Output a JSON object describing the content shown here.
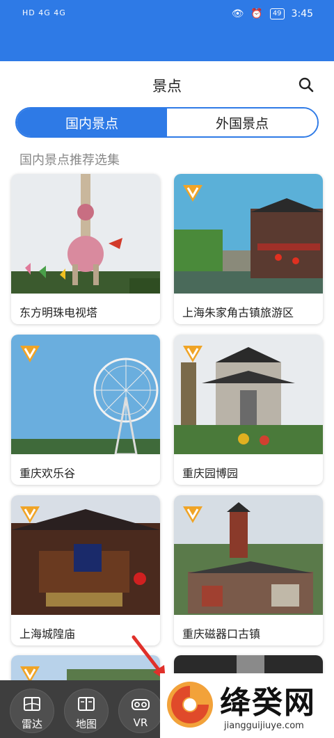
{
  "status_bar": {
    "left_text": "HD 4G 4G",
    "time": "3:45",
    "battery": "49"
  },
  "header": {
    "title": "景点",
    "search_icon": "search-icon"
  },
  "tabs": [
    {
      "label": "国内景点",
      "active": true
    },
    {
      "label": "外国景点",
      "active": false
    }
  ],
  "section_title": "国内景点推荐选集",
  "cards": [
    {
      "label": "东方明珠电视塔",
      "vip": false
    },
    {
      "label": "上海朱家角古镇旅游区",
      "vip": true
    },
    {
      "label": "重庆欢乐谷",
      "vip": true
    },
    {
      "label": "重庆园博园",
      "vip": true
    },
    {
      "label": "上海城隍庙",
      "vip": true
    },
    {
      "label": "重庆磁器口古镇",
      "vip": true
    }
  ],
  "partial_cards": [
    {
      "vip": true
    },
    {
      "vip": true
    }
  ],
  "bottom_nav": [
    {
      "label": "雷达",
      "icon": "map-fold-icon"
    },
    {
      "label": "地图",
      "icon": "book-map-icon"
    },
    {
      "label": "VR",
      "icon": "vr-glasses-icon"
    }
  ],
  "watermark": {
    "name": "绛癸网",
    "domain": "jiangguijiuye.com"
  },
  "colors": {
    "primary": "#2e7ae6",
    "badge": "#f0a426",
    "nav_bg": "#3e3e3e"
  }
}
